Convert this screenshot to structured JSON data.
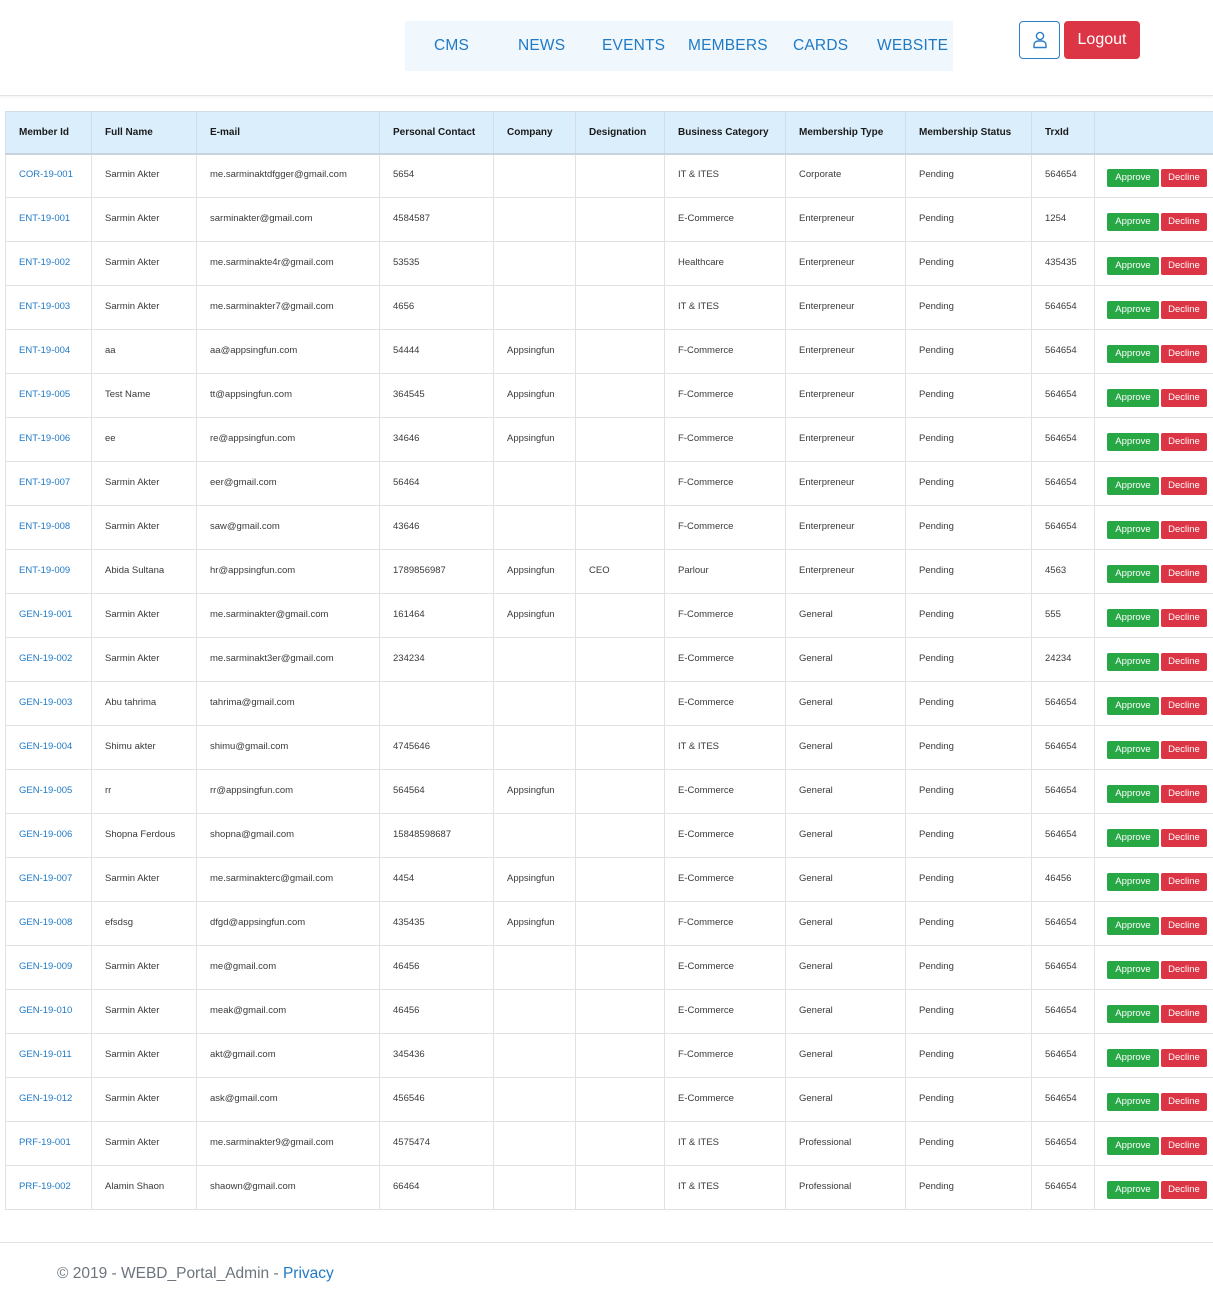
{
  "nav": {
    "items": [
      "CMS",
      "NEWS",
      "EVENTS",
      "MEMBERS",
      "CARDS",
      "WEBSITE"
    ]
  },
  "header": {
    "user_icon": "user-icon",
    "logout_label": "Logout"
  },
  "table": {
    "columns": [
      "Member Id",
      "Full Name",
      "E-mail",
      "Personal Contact",
      "Company",
      "Designation",
      "Business Category",
      "Membership Type",
      "Membership Status",
      "TrxId",
      ""
    ],
    "approve_label": "Approve",
    "decline_label": "Decline",
    "rows": [
      [
        "COR-19-001",
        "Sarmin Akter",
        "me.sarminaktdfgger@gmail.com",
        "5654",
        "",
        "",
        "IT & ITES",
        "Corporate",
        "Pending",
        "564654"
      ],
      [
        "ENT-19-001",
        "Sarmin Akter",
        "sarminakter@gmail.com",
        "4584587",
        "",
        "",
        "E-Commerce",
        "Enterpreneur",
        "Pending",
        "1254"
      ],
      [
        "ENT-19-002",
        "Sarmin Akter",
        "me.sarminakte4r@gmail.com",
        "53535",
        "",
        "",
        "Healthcare",
        "Enterpreneur",
        "Pending",
        "435435"
      ],
      [
        "ENT-19-003",
        "Sarmin Akter",
        "me.sarminakter7@gmail.com",
        "4656",
        "",
        "",
        "IT & ITES",
        "Enterpreneur",
        "Pending",
        "564654"
      ],
      [
        "ENT-19-004",
        "aa",
        "aa@appsingfun.com",
        "54444",
        "Appsingfun",
        "",
        "F-Commerce",
        "Enterpreneur",
        "Pending",
        "564654"
      ],
      [
        "ENT-19-005",
        "Test Name",
        "tt@appsingfun.com",
        "364545",
        "Appsingfun",
        "",
        "F-Commerce",
        "Enterpreneur",
        "Pending",
        "564654"
      ],
      [
        "ENT-19-006",
        "ee",
        "re@appsingfun.com",
        "34646",
        "Appsingfun",
        "",
        "F-Commerce",
        "Enterpreneur",
        "Pending",
        "564654"
      ],
      [
        "ENT-19-007",
        "Sarmin Akter",
        "eer@gmail.com",
        "56464",
        "",
        "",
        "F-Commerce",
        "Enterpreneur",
        "Pending",
        "564654"
      ],
      [
        "ENT-19-008",
        "Sarmin Akter",
        "saw@gmail.com",
        "43646",
        "",
        "",
        "F-Commerce",
        "Enterpreneur",
        "Pending",
        "564654"
      ],
      [
        "ENT-19-009",
        "Abida Sultana",
        "hr@appsingfun.com",
        "1789856987",
        "Appsingfun",
        "CEO",
        "Parlour",
        "Enterpreneur",
        "Pending",
        "4563"
      ],
      [
        "GEN-19-001",
        "Sarmin Akter",
        "me.sarminakter@gmail.com",
        "161464",
        "Appsingfun",
        "",
        "F-Commerce",
        "General",
        "Pending",
        "555"
      ],
      [
        "GEN-19-002",
        "Sarmin Akter",
        "me.sarminakt3er@gmail.com",
        "234234",
        "",
        "",
        "E-Commerce",
        "General",
        "Pending",
        "24234"
      ],
      [
        "GEN-19-003",
        "Abu tahrima",
        "tahrima@gmail.com",
        "",
        "",
        "",
        "E-Commerce",
        "General",
        "Pending",
        "564654"
      ],
      [
        "GEN-19-004",
        "Shimu akter",
        "shimu@gmail.com",
        "4745646",
        "",
        "",
        "IT & ITES",
        "General",
        "Pending",
        "564654"
      ],
      [
        "GEN-19-005",
        "rr",
        "rr@appsingfun.com",
        "564564",
        "Appsingfun",
        "",
        "E-Commerce",
        "General",
        "Pending",
        "564654"
      ],
      [
        "GEN-19-006",
        "Shopna Ferdous",
        "shopna@gmail.com",
        "15848598687",
        "",
        "",
        "E-Commerce",
        "General",
        "Pending",
        "564654"
      ],
      [
        "GEN-19-007",
        "Sarmin Akter",
        "me.sarminakterc@gmail.com",
        "4454",
        "Appsingfun",
        "",
        "E-Commerce",
        "General",
        "Pending",
        "46456"
      ],
      [
        "GEN-19-008",
        "efsdsg",
        "dfgd@appsingfun.com",
        "435435",
        "Appsingfun",
        "",
        "F-Commerce",
        "General",
        "Pending",
        "564654"
      ],
      [
        "GEN-19-009",
        "Sarmin Akter",
        "me@gmail.com",
        "46456",
        "",
        "",
        "E-Commerce",
        "General",
        "Pending",
        "564654"
      ],
      [
        "GEN-19-010",
        "Sarmin Akter",
        "meak@gmail.com",
        "46456",
        "",
        "",
        "E-Commerce",
        "General",
        "Pending",
        "564654"
      ],
      [
        "GEN-19-011",
        "Sarmin Akter",
        "akt@gmail.com",
        "345436",
        "",
        "",
        "F-Commerce",
        "General",
        "Pending",
        "564654"
      ],
      [
        "GEN-19-012",
        "Sarmin Akter",
        "ask@gmail.com",
        "456546",
        "",
        "",
        "E-Commerce",
        "General",
        "Pending",
        "564654"
      ],
      [
        "PRF-19-001",
        "Sarmin Akter",
        "me.sarminakter9@gmail.com",
        "4575474",
        "",
        "",
        "IT & ITES",
        "Professional",
        "Pending",
        "564654"
      ],
      [
        "PRF-19-002",
        "Alamin Shaon",
        "shaown@gmail.com",
        "66464",
        "",
        "",
        "IT & ITES",
        "Professional",
        "Pending",
        "564654"
      ]
    ]
  },
  "footer": {
    "copyright": "© 2019 - WEBD_Portal_Admin - ",
    "privacy_label": "Privacy"
  },
  "colors": {
    "accent": "#1f7ac6",
    "approve": "#28a745",
    "decline": "#dc3545",
    "header_bg": "#dbeefc"
  }
}
